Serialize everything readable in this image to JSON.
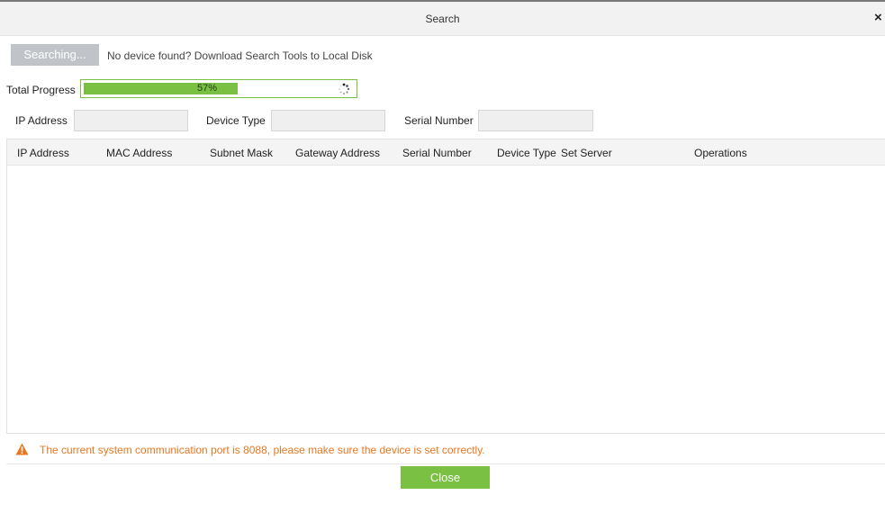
{
  "dialog": {
    "title": "Search",
    "close_glyph": "×"
  },
  "toolbar": {
    "search_button_label": "Searching...",
    "download_link_text": "No device found? Download Search Tools to Local Disk"
  },
  "progress": {
    "label": "Total Progress",
    "value": 0.57,
    "text": "57%",
    "bar_color": "#7ac143",
    "icon": "spinner-icon"
  },
  "filters": {
    "ip_label": "IP Address",
    "ip_value": "",
    "device_type_label": "Device Type",
    "device_type_value": "",
    "serial_label": "Serial Number",
    "serial_value": ""
  },
  "table": {
    "columns": [
      "IP Address",
      "MAC Address",
      "Subnet Mask",
      "Gateway Address",
      "Serial Number",
      "Device Type",
      "Set Server",
      "Operations"
    ],
    "rows": []
  },
  "warning": {
    "icon": "warning-icon",
    "text": "The current system communication port is 8088, please make sure the device is set correctly.",
    "color": "#e87722"
  },
  "footer": {
    "close_label": "Close",
    "accent": "#7ac143"
  }
}
